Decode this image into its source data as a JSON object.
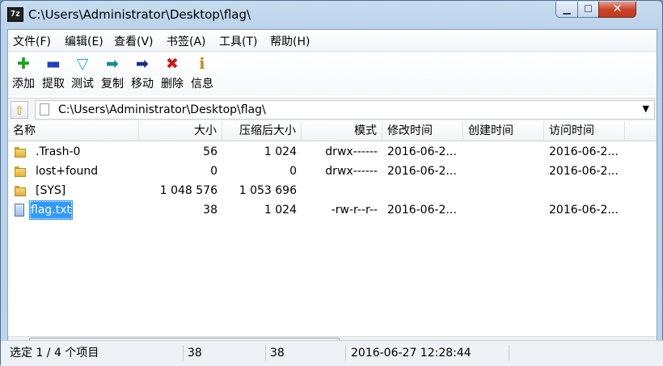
{
  "window": {
    "title": "C:\\Users\\Administrator\\Desktop\\flag\\",
    "app_icon": "7z",
    "min_glyph": "▁",
    "max_glyph": "☐",
    "close_glyph": "✕"
  },
  "menu": [
    "文件(F)",
    "编辑(E)",
    "查看(V)",
    "书签(A)",
    "工具(T)",
    "帮助(H)"
  ],
  "toolbar": [
    {
      "label": "添加",
      "icon": "add-icon",
      "glyph": "✚",
      "color": "#1aa51a"
    },
    {
      "label": "提取",
      "icon": "extract-icon",
      "glyph": "▬",
      "color": "#1f3fbf"
    },
    {
      "label": "测试",
      "icon": "test-icon",
      "glyph": "▽",
      "color": "#2ab5c8"
    },
    {
      "label": "复制",
      "icon": "copy-icon",
      "glyph": "➡",
      "color": "#1a8c8c"
    },
    {
      "label": "移动",
      "icon": "move-icon",
      "glyph": "➡",
      "color": "#1b2a8a"
    },
    {
      "label": "删除",
      "icon": "delete-icon",
      "glyph": "✖",
      "color": "#d01818"
    },
    {
      "label": "信息",
      "icon": "info-icon",
      "glyph": "ℹ",
      "color": "#b8900a"
    }
  ],
  "address": {
    "path": "C:\\Users\\Administrator\\Desktop\\flag\\",
    "up_glyph": "⇧",
    "drop_glyph": "▼"
  },
  "columns": [
    "名称",
    "大小",
    "压缩后大小",
    "模式",
    "修改时间",
    "创建时间",
    "访问时间"
  ],
  "rows": [
    {
      "type": "folder",
      "name": ".Trash-0",
      "size": "56",
      "packed": "1 024",
      "mode": "drwx------",
      "modified": "2016-06-2...",
      "created": "",
      "accessed": "2016-06-2..."
    },
    {
      "type": "folder",
      "name": "lost+found",
      "size": "0",
      "packed": "0",
      "mode": "drwx------",
      "modified": "2016-06-2...",
      "created": "",
      "accessed": "2016-06-2..."
    },
    {
      "type": "folder",
      "name": "[SYS]",
      "size": "1 048 576",
      "packed": "1 053 696",
      "mode": "",
      "modified": "",
      "created": "",
      "accessed": ""
    },
    {
      "type": "file",
      "name": "flag.txt",
      "size": "38",
      "packed": "1 024",
      "mode": "-rw-r--r--",
      "modified": "2016-06-2...",
      "created": "",
      "accessed": "2016-06-2...",
      "selected": true
    }
  ],
  "scroll": {
    "left_glyph": "◀",
    "right_glyph": "▶",
    "thumb_grip": "|||"
  },
  "status": {
    "selection": "选定 1 / 4 个项目",
    "size": "38",
    "packed": "38",
    "modified": "2016-06-27 12:28:44"
  }
}
